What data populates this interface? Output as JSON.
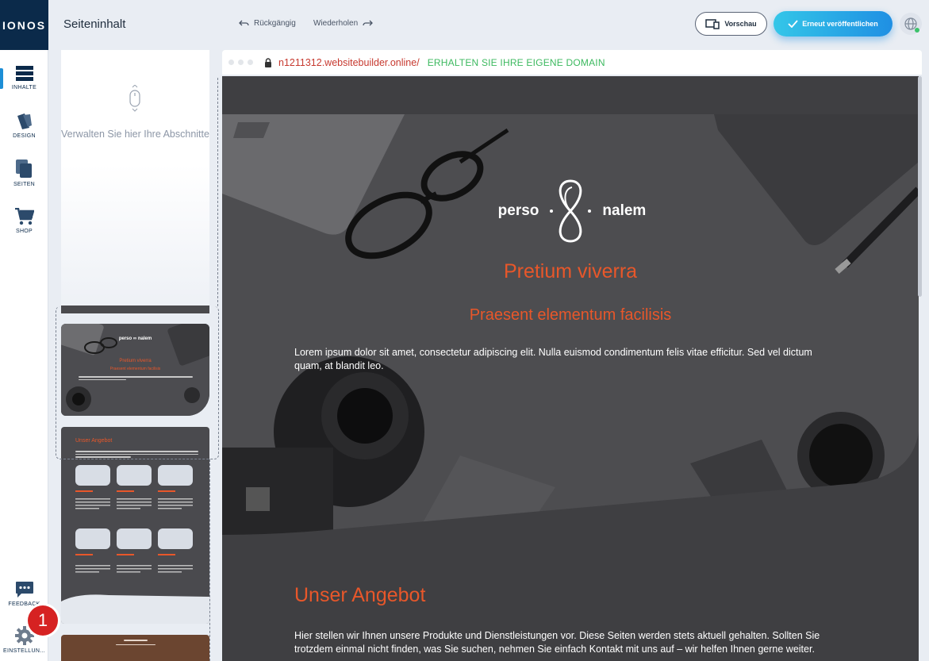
{
  "app": {
    "logo_text": "IONOS"
  },
  "sidebar": {
    "items": [
      {
        "label": "INHALTE",
        "icon": "content-icon",
        "active": true
      },
      {
        "label": "DESIGN",
        "icon": "palette-icon"
      },
      {
        "label": "SEITEN",
        "icon": "pages-icon"
      },
      {
        "label": "SHOP",
        "icon": "cart-icon"
      }
    ],
    "bottom": [
      {
        "label": "FEEDBACK",
        "icon": "chat-icon"
      },
      {
        "label": "EINSTELLUN...",
        "icon": "gear-icon"
      }
    ],
    "badge": "1"
  },
  "header": {
    "title": "Seiteninhalt",
    "undo_label": "Rückgängig",
    "redo_label": "Wiederholen",
    "preview_label": "Vorschau",
    "publish_label": "Erneut veröffentlichen"
  },
  "sections_panel": {
    "hint": "Verwalten Sie hier Ihre Abschnitte",
    "thumb2": {
      "brand_left": "perso",
      "brand_right": "nalem",
      "title": "Pretium viverra",
      "subtitle": "Praesent elementum facilisis"
    },
    "thumb3": {
      "title": "Unser Angebot"
    }
  },
  "browser": {
    "url": "n1211312.websitebuilder.online/",
    "domain_cta": "ERHALTEN SIE IHRE EIGENE DOMAIN"
  },
  "site": {
    "brand_left": "perso",
    "brand_right": "nalem",
    "hero_title": "Pretium viverra",
    "hero_subtitle": "Praesent elementum facilisis",
    "hero_text": "Lorem ipsum dolor sit amet, consectetur adipiscing elit. Nulla euismod condimentum felis vitae efficitur. Sed vel dictum quam, at blandit leo.",
    "section_title": "Unser Angebot",
    "section_text": "Hier stellen wir Ihnen unsere Produkte und Dienstleistungen vor. Diese Seiten werden stets aktuell gehalten. Sollten Sie trotzdem einmal nicht finden, was Sie suchen, nehmen Sie einfach Kontakt mit uns auf – wir helfen Ihnen gerne weiter."
  },
  "colors": {
    "accent": "#e8572a",
    "navy": "#0b2a4a",
    "publish": "#1f8fe3",
    "link_green": "#3cb95f"
  }
}
